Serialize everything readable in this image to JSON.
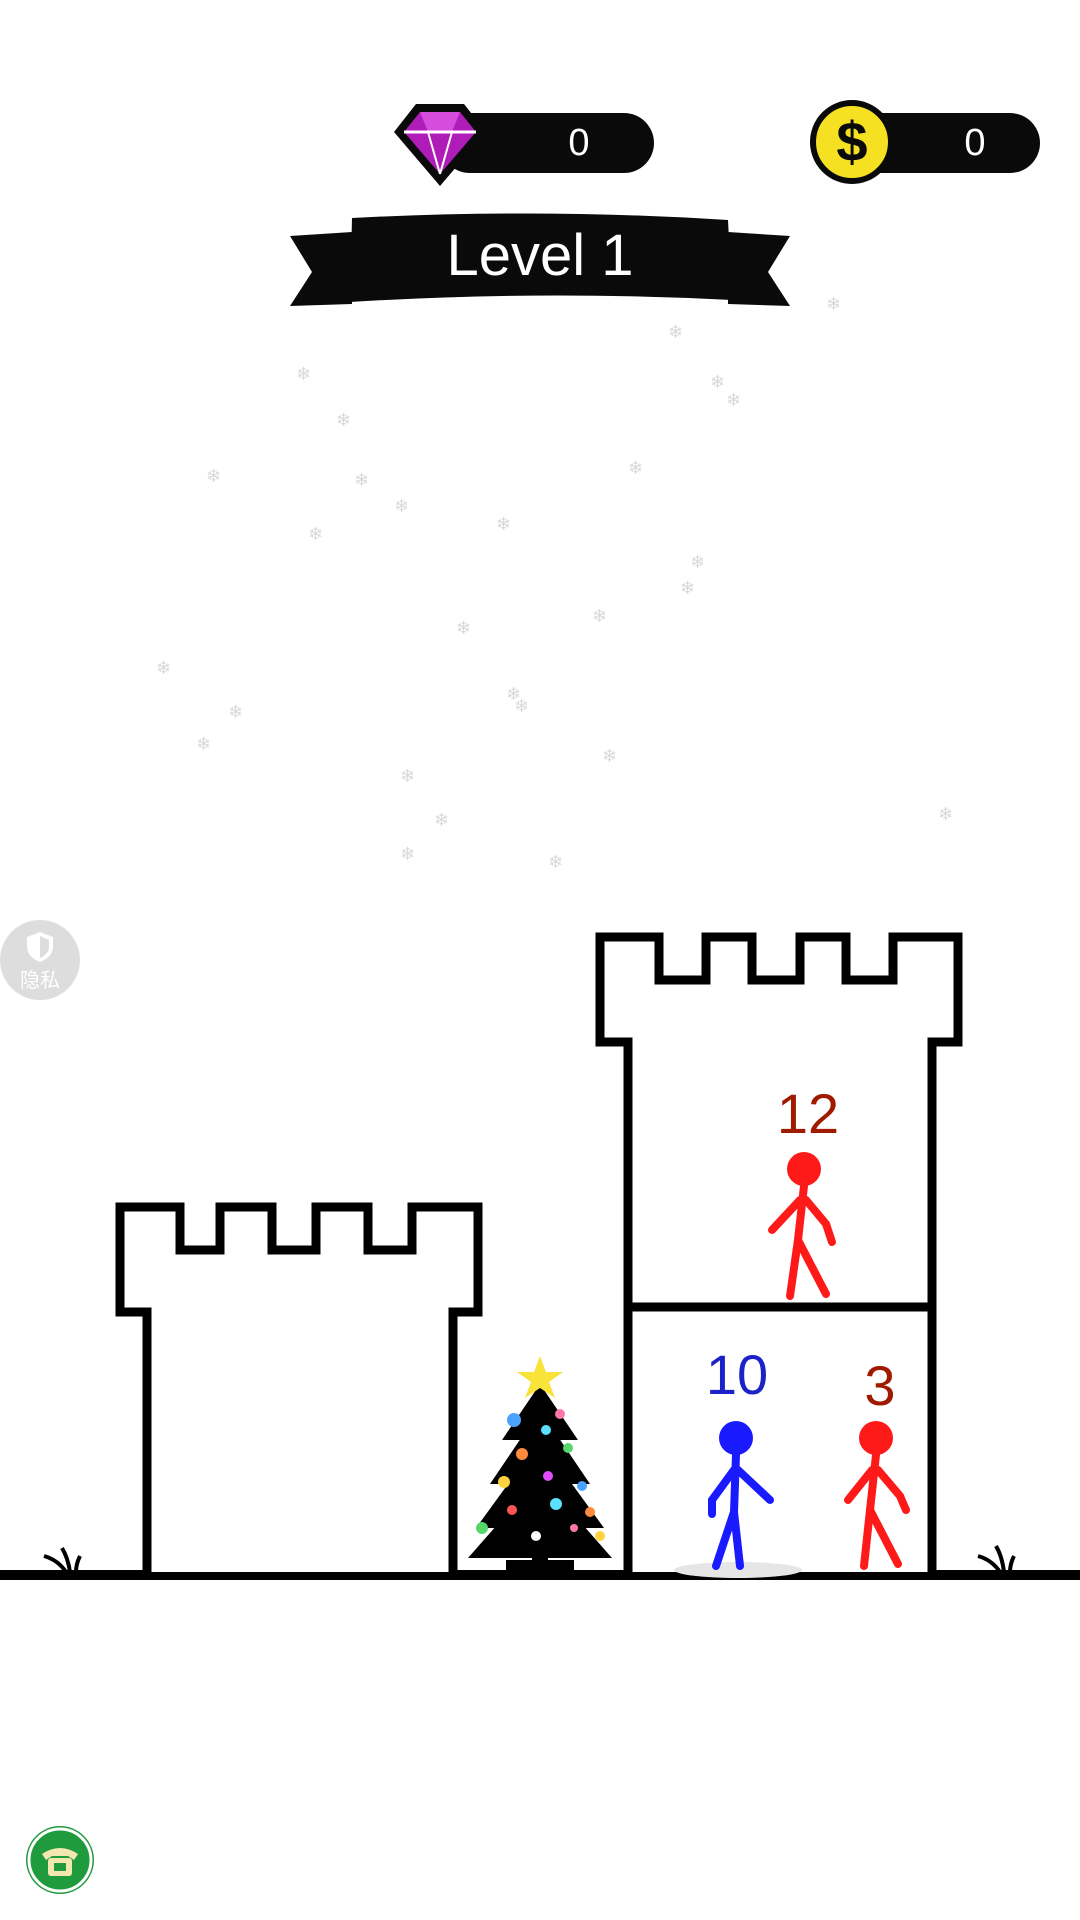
{
  "hud": {
    "gems": {
      "icon": "gem-icon",
      "value": "0",
      "color": "#b01cb8"
    },
    "coins": {
      "icon": "dollar-coin-icon",
      "symbol": "$",
      "value": "0",
      "color": "#f5e021"
    }
  },
  "level": {
    "label": "Level 1"
  },
  "towers": {
    "player": {
      "name": "left-tower",
      "floors": 1
    },
    "enemy": {
      "name": "right-tower",
      "floors": [
        {
          "floor": "top",
          "units": [
            {
              "team": "enemy",
              "power": "12",
              "color": "#ff1a1a"
            }
          ]
        },
        {
          "floor": "bottom",
          "units": [
            {
              "team": "player",
              "power": "10",
              "color": "#1a1aff"
            },
            {
              "team": "enemy",
              "power": "3",
              "color": "#ff1a1a"
            }
          ]
        }
      ]
    }
  },
  "power_label_colors": {
    "enemy": "#a01a00",
    "player": "#1a22c8"
  },
  "decor": {
    "tree": "christmas-tree-icon",
    "snow": "snowflake-icon"
  },
  "overlays": {
    "privacy": {
      "icon": "shield-icon",
      "label": "隐私"
    },
    "support": {
      "icon": "phone-icon"
    }
  }
}
